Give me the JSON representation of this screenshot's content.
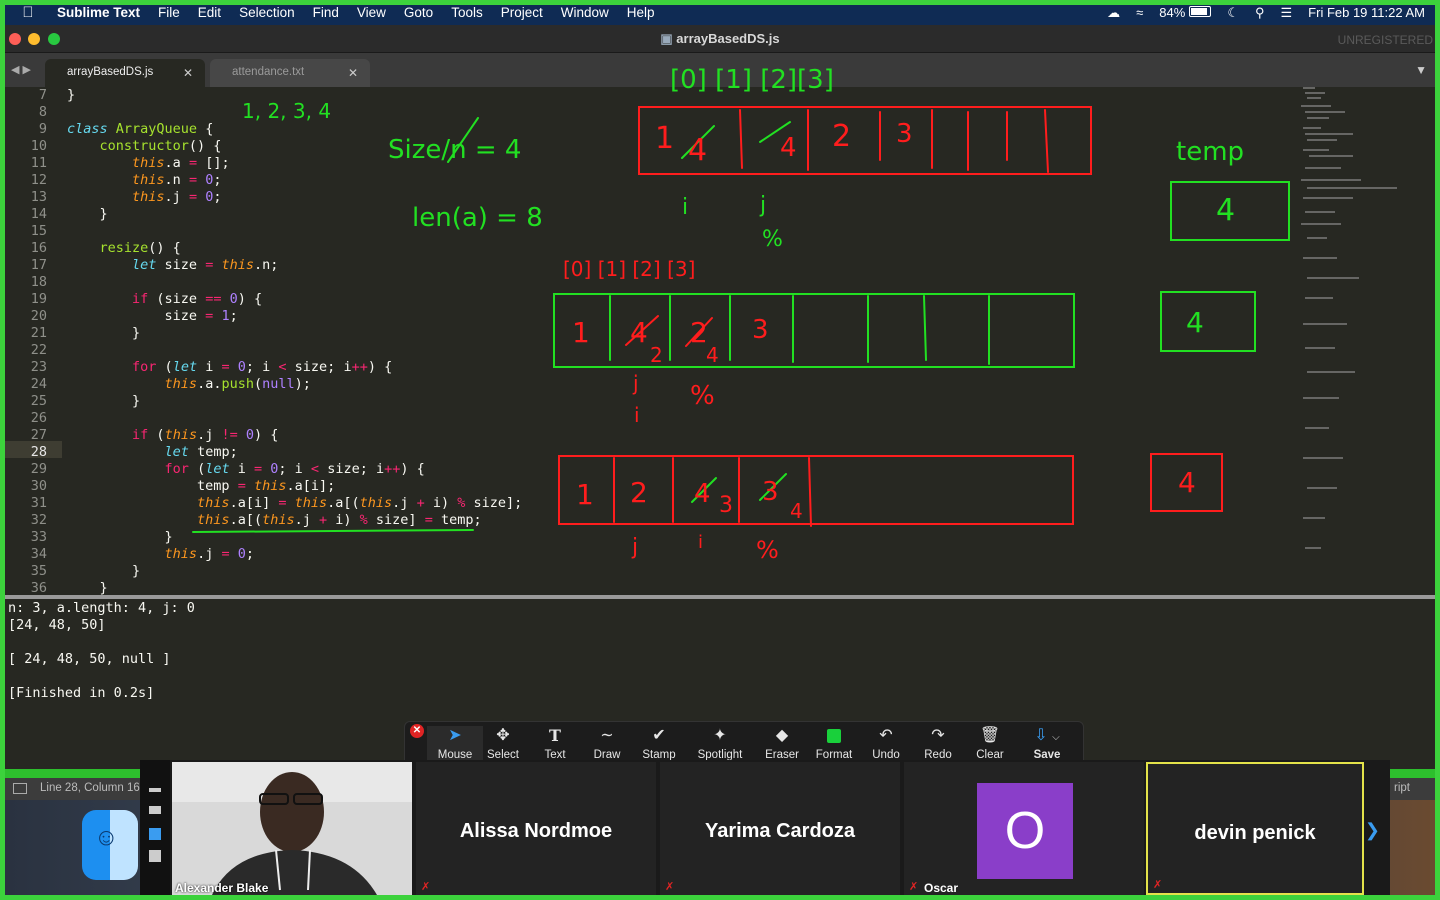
{
  "menubar": {
    "app": "Sublime Text",
    "items": [
      "File",
      "Edit",
      "Selection",
      "Find",
      "View",
      "Goto",
      "Tools",
      "Project",
      "Window",
      "Help"
    ],
    "battery": "84%",
    "datetime": "Fri Feb 19  11:22 AM"
  },
  "window": {
    "title": "arrayBasedDS.js",
    "unregistered": "UNREGISTERED"
  },
  "tabs": [
    {
      "label": "arrayBasedDS.js",
      "active": true
    },
    {
      "label": "attendance.txt",
      "active": false
    }
  ],
  "editor": {
    "current_line": 28,
    "lines": [
      {
        "n": "7",
        "html": "}"
      },
      {
        "n": "8",
        "html": ""
      },
      {
        "n": "9",
        "html": "<span class='kw'>class</span> <span class='cls'>ArrayQueue</span> {"
      },
      {
        "n": "10",
        "html": "    <span class='fn'>constructor</span>() {"
      },
      {
        "n": "11",
        "html": "        <span class='this'>this</span>.a <span class='op'>=</span> [];"
      },
      {
        "n": "12",
        "html": "        <span class='this'>this</span>.n <span class='op'>=</span> <span class='num'>0</span>;"
      },
      {
        "n": "13",
        "html": "        <span class='this'>this</span>.j <span class='op'>=</span> <span class='num'>0</span>;"
      },
      {
        "n": "14",
        "html": "    }"
      },
      {
        "n": "15",
        "html": ""
      },
      {
        "n": "16",
        "html": "    <span class='fn'>resize</span>() {"
      },
      {
        "n": "17",
        "html": "        <span class='kw'>let</span> size <span class='op'>=</span> <span class='this'>this</span>.n;"
      },
      {
        "n": "18",
        "html": ""
      },
      {
        "n": "19",
        "html": "        <span class='kw2'>if</span> (size <span class='op'>==</span> <span class='num'>0</span>) {"
      },
      {
        "n": "20",
        "html": "            size <span class='op'>=</span> <span class='num'>1</span>;"
      },
      {
        "n": "21",
        "html": "        }"
      },
      {
        "n": "22",
        "html": ""
      },
      {
        "n": "23",
        "html": "        <span class='kw2'>for</span> (<span class='kw'>let</span> i <span class='op'>=</span> <span class='num'>0</span>; i <span class='op'>&lt;</span> size; i<span class='op'>++</span>) {"
      },
      {
        "n": "24",
        "html": "            <span class='this'>this</span>.a.<span class='fn'>push</span>(<span class='num'>null</span>);"
      },
      {
        "n": "25",
        "html": "        }"
      },
      {
        "n": "26",
        "html": ""
      },
      {
        "n": "27",
        "html": "        <span class='kw2'>if</span> (<span class='this'>this</span>.j <span class='op'>!=</span> <span class='num'>0</span>) {"
      },
      {
        "n": "28",
        "html": "            <span class='kw'>let</span> temp;"
      },
      {
        "n": "29",
        "html": "            <span class='kw2'>for</span> (<span class='kw'>let</span> i <span class='op'>=</span> <span class='num'>0</span>; i <span class='op'>&lt;</span> size; i<span class='op'>++</span>) {"
      },
      {
        "n": "30",
        "html": "                temp <span class='op'>=</span> <span class='this'>this</span>.a[i];"
      },
      {
        "n": "31",
        "html": "                <span class='this'>this</span>.a[i] <span class='op'>=</span> <span class='this'>this</span>.a[(<span class='this'>this</span>.j <span class='op'>+</span> i) <span class='op'>%</span> size];"
      },
      {
        "n": "32",
        "html": "                <span class='this'>this</span>.a[(<span class='this'>this</span>.j <span class='op'>+</span> i) <span class='op'>%</span> size] <span class='op'>=</span> temp;"
      },
      {
        "n": "33",
        "html": "            }"
      },
      {
        "n": "34",
        "html": "            <span class='this'>this</span>.j <span class='op'>=</span> <span class='num'>0</span>;"
      },
      {
        "n": "35",
        "html": "        }"
      },
      {
        "n": "36",
        "html": "    }"
      }
    ]
  },
  "annotations": {
    "top_indices": "[0]  [1]  [2][3]",
    "seq": "1, 2, 3, 4",
    "size_n": "Size/n = 4",
    "len_a": "len(a) = 8",
    "temp_label": "temp",
    "temp_values": [
      "4",
      "4",
      "4"
    ],
    "row1_cells": [
      "1",
      "4",
      "4",
      "2",
      "3"
    ],
    "row1_marks": [
      "i",
      "j",
      "%"
    ],
    "mid_indices": "[0]  [1]  [2]  [3]",
    "row2_cells": [
      "1",
      "4",
      "2",
      "2",
      "4",
      "3"
    ],
    "row2_marks": [
      "j",
      "i",
      "%"
    ],
    "row3_cells": [
      "1",
      "2",
      "4",
      "3",
      "3",
      "4"
    ],
    "row3_marks": [
      "j",
      "i",
      "%"
    ]
  },
  "output": {
    "lines": [
      "n: 3, a.length: 4, j: 0",
      "[24, 48, 50]",
      "",
      "[ 24, 48, 50, null ]",
      "",
      "[Finished in 0.2s]"
    ]
  },
  "statusbar": {
    "position": "Line 28, Column 16",
    "syntax": "ript"
  },
  "zoom_toolbar": {
    "tools": [
      {
        "label": "Mouse",
        "icon": "cursor-icon"
      },
      {
        "label": "Select",
        "icon": "move-icon"
      },
      {
        "label": "Text",
        "icon": "text-icon"
      },
      {
        "label": "Draw",
        "icon": "draw-icon"
      },
      {
        "label": "Stamp",
        "icon": "checkmark-icon"
      },
      {
        "label": "Spotlight",
        "icon": "wand-icon"
      },
      {
        "label": "Eraser",
        "icon": "eraser-icon"
      },
      {
        "label": "Format",
        "icon": "format-icon"
      },
      {
        "label": "Undo",
        "icon": "undo-icon"
      },
      {
        "label": "Redo",
        "icon": "redo-icon"
      },
      {
        "label": "Clear",
        "icon": "trash-icon"
      },
      {
        "label": "Save",
        "icon": "save-icon"
      }
    ]
  },
  "participants": [
    {
      "name": "Alexander Blake",
      "video": true
    },
    {
      "name": "Alissa Nordmoe",
      "video": false
    },
    {
      "name": "Yarima Cardoza",
      "video": false
    },
    {
      "name": "Oscar",
      "avatar": "O",
      "video": false
    },
    {
      "name": "devin penick",
      "video": false
    }
  ],
  "colors": {
    "editor_bg": "#272822",
    "annotation_red": "#ff1d1d",
    "annotation_green": "#22e022",
    "share_border": "#3cd23c"
  }
}
